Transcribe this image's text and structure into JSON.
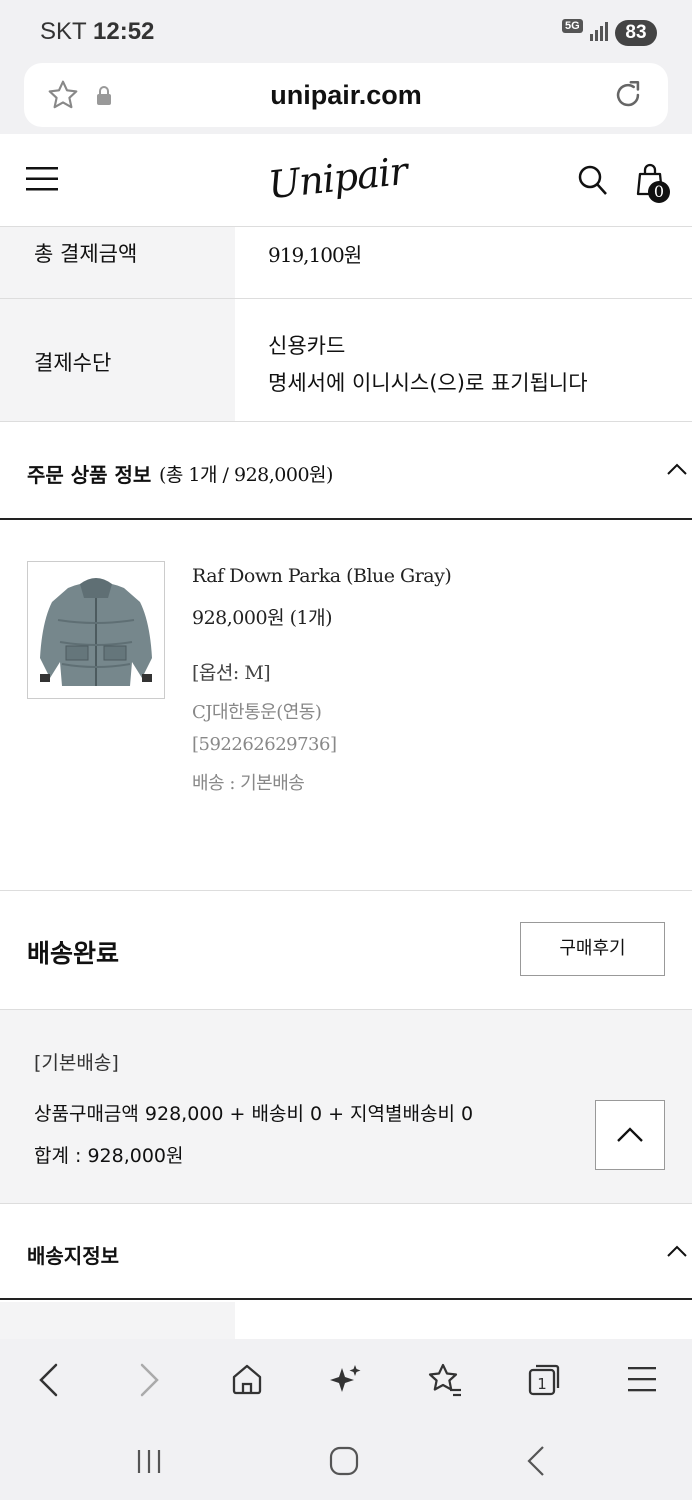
{
  "status": {
    "carrier": "SKT",
    "time": "12:52",
    "network": "5G",
    "battery": "83"
  },
  "browser": {
    "url": "unipair.com"
  },
  "header": {
    "logo": "Unipair",
    "cart_count": "0"
  },
  "payment": {
    "total_label": "총 결제금액",
    "total_value": "919,100원",
    "method_label": "결제수단",
    "method_value": "신용카드",
    "method_note": "명세서에 이니시스(으)로 표기됩니다"
  },
  "order_items": {
    "title": "주문 상품 정보",
    "summary": "(총 1개 / 928,000원)",
    "item": {
      "name": "Raf Down Parka (Blue Gray)",
      "price": "928,000원 (1개)",
      "option": "[옵션: M]",
      "courier": "CJ대한통운(연동)",
      "tracking": "[592262629736]",
      "shipping_type": "배송 : 기본배송"
    }
  },
  "delivery_status": {
    "label": "배송완료",
    "review_button": "구매후기"
  },
  "shipping_summary": {
    "type": "[기본배송]",
    "breakdown": "상품구매금액 928,000 + 배송비 0 + 지역별배송비 0",
    "total": "합계 : 928,000원"
  },
  "shipping_address": {
    "title": "배송지정보"
  },
  "colors": {
    "accent": "#111111",
    "label_bg": "#f4f4f5",
    "chrome_bg": "#f1f1f3"
  }
}
